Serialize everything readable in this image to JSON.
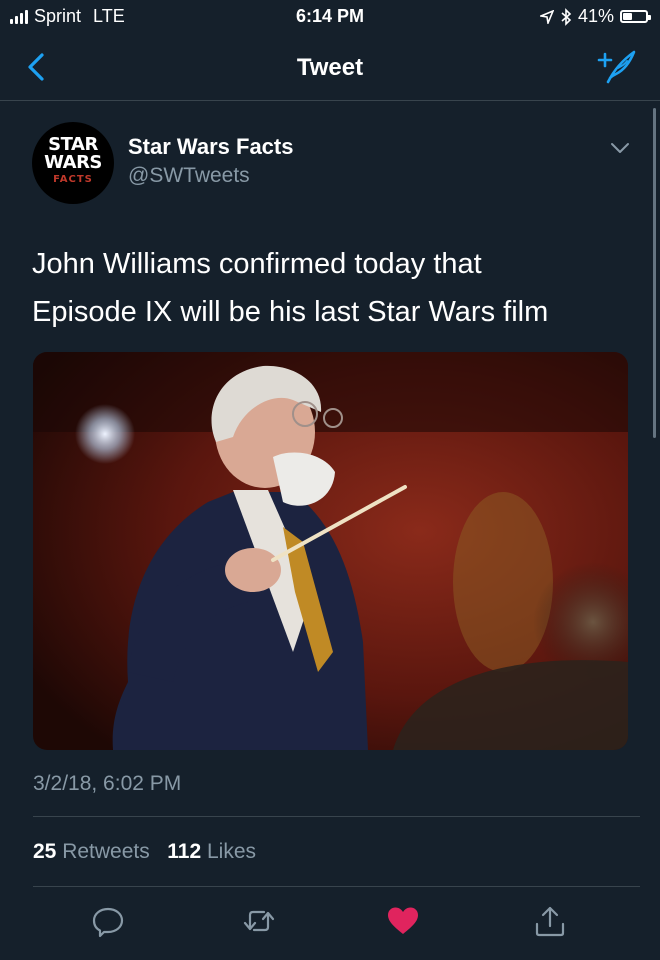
{
  "status_bar": {
    "carrier": "Sprint",
    "network": "LTE",
    "time": "6:14 PM",
    "battery": "41%",
    "battery_level": 0.41
  },
  "nav": {
    "title": "Tweet",
    "back_icon": "chevron-left-icon",
    "compose_icon": "compose-tweet-icon"
  },
  "tweet": {
    "avatar_text": [
      "STAR",
      "WARS",
      "FACTS"
    ],
    "display_name": "Star Wars Facts",
    "handle": "@SWTweets",
    "text_line1": "John Williams confirmed today that",
    "text_line2": "Episode IX will be his last Star Wars film",
    "timestamp": "3/2/18, 6:02 PM",
    "retweets_count": "25",
    "retweets_label": "Retweets",
    "likes_count": "112",
    "likes_label": "Likes"
  },
  "actions": [
    {
      "name": "reply-icon"
    },
    {
      "name": "retweet-icon"
    },
    {
      "name": "like-icon"
    },
    {
      "name": "share-icon"
    }
  ],
  "colors": {
    "background": "#15202b",
    "accent": "#1da1f2",
    "secondary_text": "#8899a6",
    "like": "#e0245e",
    "divider": "#38444d"
  }
}
